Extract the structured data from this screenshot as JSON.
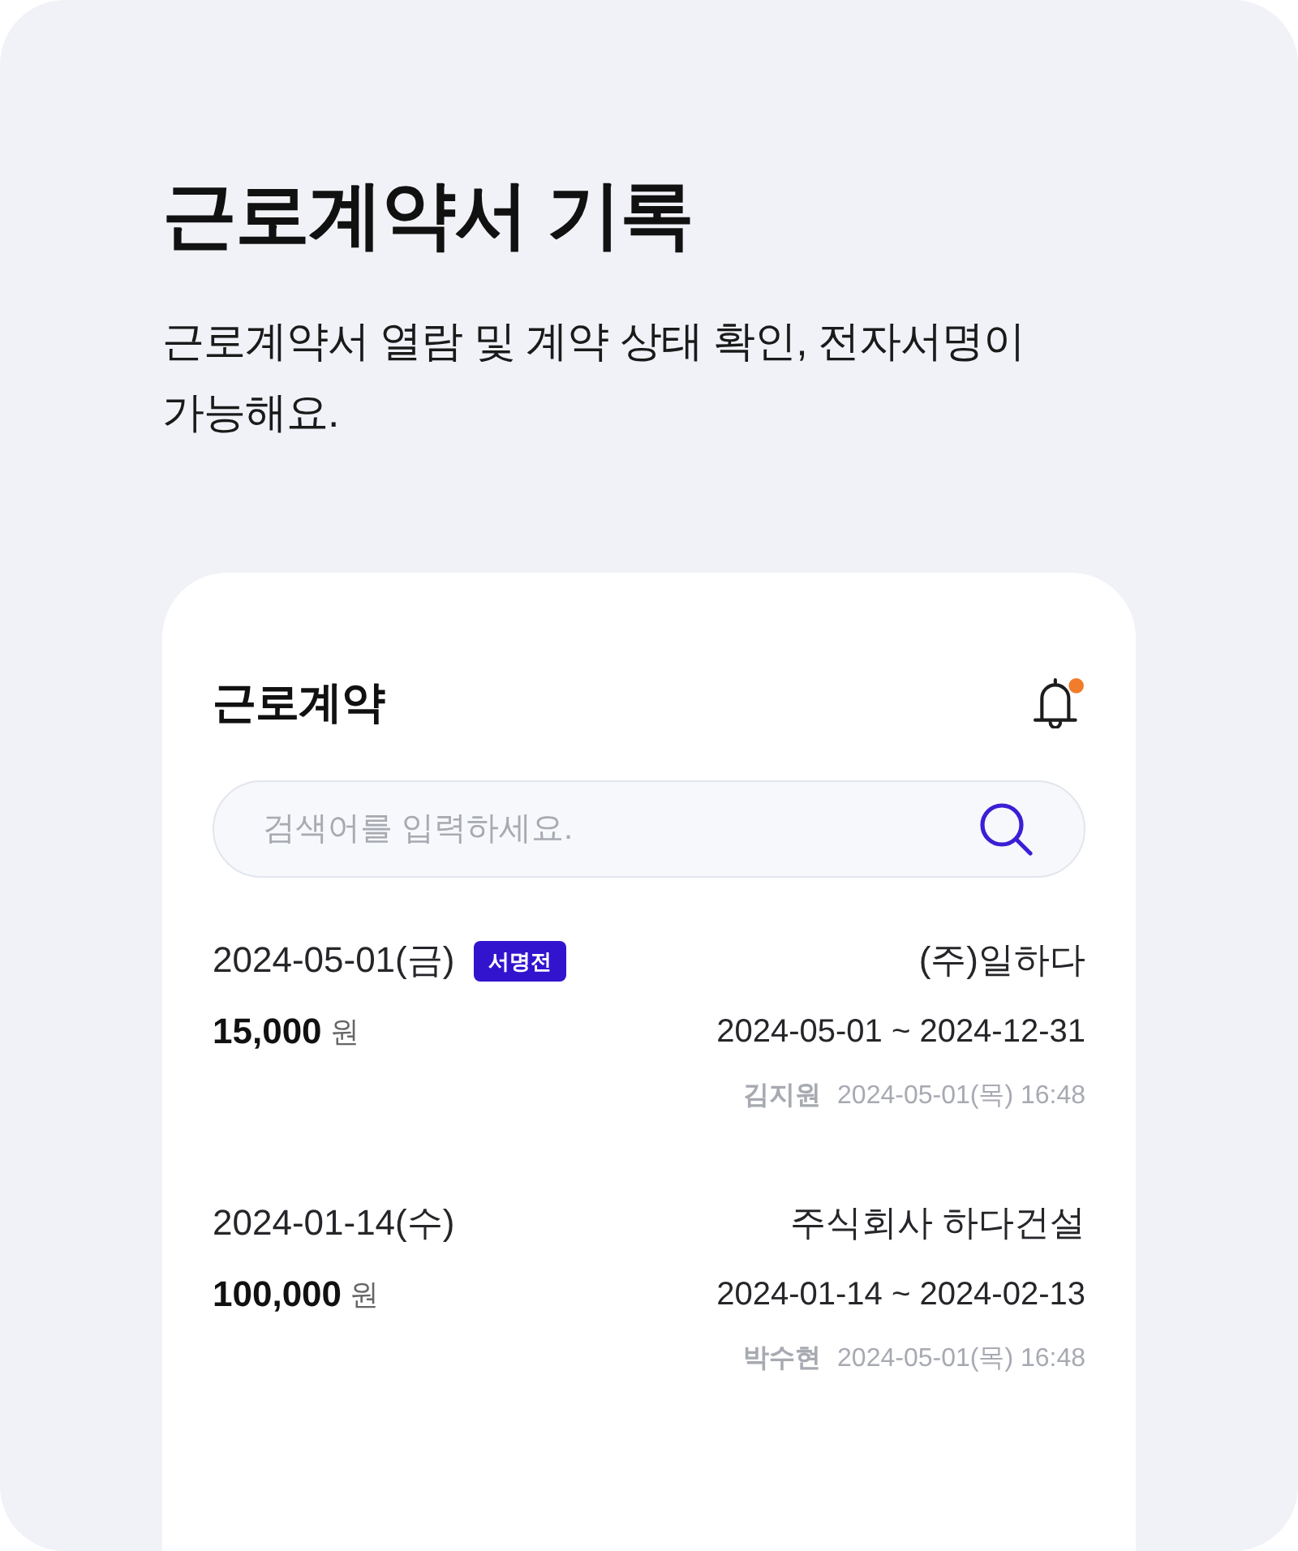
{
  "page": {
    "title": "근로계약서 기록",
    "description": "근로계약서 열람 및 계약 상태 확인, 전자서명이 가능해요."
  },
  "card": {
    "title": "근로계약",
    "notification": {
      "unread": true
    },
    "search": {
      "placeholder": "검색어를 입력하세요."
    },
    "contracts": [
      {
        "date": "2024-05-01(금)",
        "badge": "서명전",
        "company": "(주)일하다",
        "amount": "15,000",
        "unit": "원",
        "period": "2024-05-01 ~ 2024-12-31",
        "author": "김지원",
        "timestamp": "2024-05-01(목) 16:48"
      },
      {
        "date": "2024-01-14(수)",
        "company": "주식회사 하다건설",
        "amount": "100,000",
        "unit": "원",
        "period": "2024-01-14 ~ 2024-02-13",
        "author": "박수현",
        "timestamp": "2024-05-01(목) 16:48"
      }
    ]
  }
}
